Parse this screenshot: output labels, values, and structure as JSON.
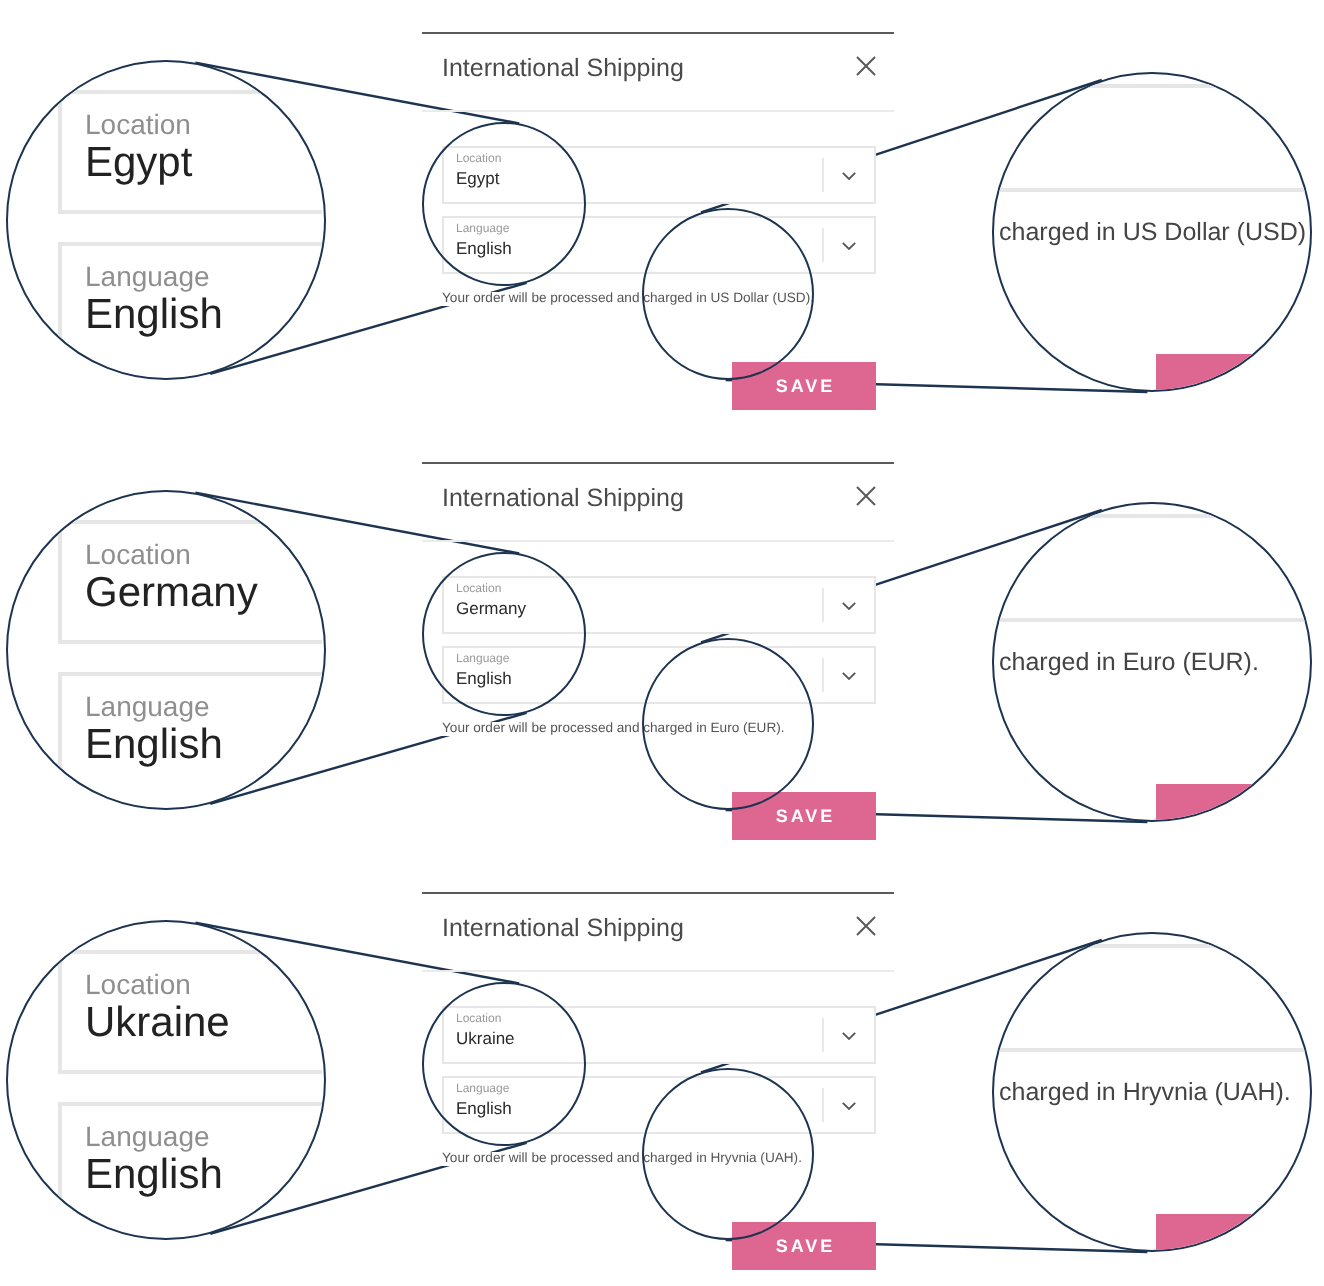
{
  "panels": [
    {
      "dialog": {
        "title": "International Shipping",
        "fields": [
          {
            "label": "Location",
            "value": "Egypt"
          },
          {
            "label": "Language",
            "value": "English"
          }
        ],
        "note": "Your order will be processed and charged in US Dollar (USD).",
        "button": "SAVE"
      },
      "field_zoom": {
        "fields": [
          {
            "label": "Location",
            "value": "Egypt"
          },
          {
            "label": "Language",
            "value": "English"
          }
        ]
      },
      "note_zoom": {
        "text": "charged in US Dollar (USD)"
      }
    },
    {
      "dialog": {
        "title": "International Shipping",
        "fields": [
          {
            "label": "Location",
            "value": "Germany"
          },
          {
            "label": "Language",
            "value": "English"
          }
        ],
        "note": "Your order will be processed and charged in Euro (EUR).",
        "button": "SAVE"
      },
      "field_zoom": {
        "fields": [
          {
            "label": "Location",
            "value": "Germany"
          },
          {
            "label": "Language",
            "value": "English"
          }
        ]
      },
      "note_zoom": {
        "text": "charged in Euro (EUR)."
      }
    },
    {
      "dialog": {
        "title": "International Shipping",
        "fields": [
          {
            "label": "Location",
            "value": "Ukraine"
          },
          {
            "label": "Language",
            "value": "English"
          }
        ],
        "note": "Your order will be processed and charged in Hryvnia (UAH).",
        "button": "SAVE"
      },
      "field_zoom": {
        "fields": [
          {
            "label": "Location",
            "value": "Ukraine"
          },
          {
            "label": "Language",
            "value": "English"
          }
        ]
      },
      "note_zoom": {
        "text": "charged in Hryvnia (UAH)."
      }
    }
  ]
}
